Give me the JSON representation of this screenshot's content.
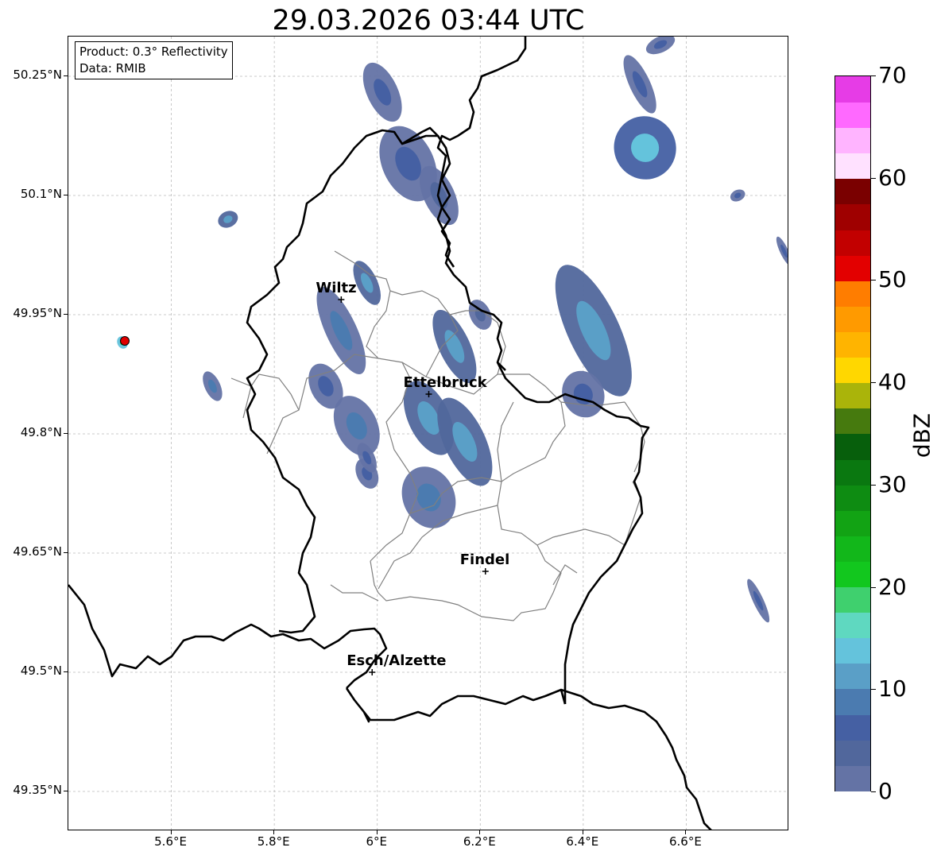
{
  "title": "29.03.2026 03:44 UTC",
  "info": {
    "product": "Product: 0.3° Reflectivity",
    "data": "Data: RMIB"
  },
  "axes": {
    "lon_range": [
      5.4,
      6.8
    ],
    "lat_range": [
      49.3,
      50.3
    ],
    "x_ticks": [
      {
        "value": 5.6,
        "label": "5.6°E"
      },
      {
        "value": 5.8,
        "label": "5.8°E"
      },
      {
        "value": 6.0,
        "label": "6°E"
      },
      {
        "value": 6.2,
        "label": "6.2°E"
      },
      {
        "value": 6.4,
        "label": "6.4°E"
      },
      {
        "value": 6.6,
        "label": "6.6°E"
      }
    ],
    "y_ticks": [
      {
        "value": 50.25,
        "label": "50.25°N"
      },
      {
        "value": 50.1,
        "label": "50.1°N"
      },
      {
        "value": 49.95,
        "label": "49.95°N"
      },
      {
        "value": 49.8,
        "label": "49.8°N"
      },
      {
        "value": 49.65,
        "label": "49.65°N"
      },
      {
        "value": 49.5,
        "label": "49.5°N"
      },
      {
        "value": 49.35,
        "label": "49.35°N"
      }
    ],
    "grid": true
  },
  "cities": [
    {
      "name": "Wiltz",
      "lon": 5.93,
      "lat": 49.969
    },
    {
      "name": "Ettelbruck",
      "lon": 6.1,
      "lat": 49.85
    },
    {
      "name": "Findel",
      "lon": 6.21,
      "lat": 49.627
    },
    {
      "name": "Esch/Alzette",
      "lon": 5.99,
      "lat": 49.5
    }
  ],
  "radar_site": {
    "lon": 5.505,
    "lat": 49.915
  },
  "colorbar": {
    "label": "dBZ",
    "min": 0,
    "max": 70,
    "ticks": [
      {
        "value": 0,
        "label": "0"
      },
      {
        "value": 10,
        "label": "10"
      },
      {
        "value": 20,
        "label": "20"
      },
      {
        "value": 30,
        "label": "30"
      },
      {
        "value": 40,
        "label": "40"
      },
      {
        "value": 50,
        "label": "50"
      },
      {
        "value": 60,
        "label": "60"
      },
      {
        "value": 70,
        "label": "70"
      }
    ],
    "colors": [
      "#6473a5",
      "#51679c",
      "#4560a3",
      "#4b7bb0",
      "#5a9fc7",
      "#64c3dc",
      "#5fd8c0",
      "#3fd06e",
      "#12c71e",
      "#12b71a",
      "#12a314",
      "#0e8c12",
      "#0a7810",
      "#075f0c",
      "#467a0e",
      "#aab40a",
      "#ffd700",
      "#ffb400",
      "#ff9a00",
      "#ff7d00",
      "#e30000",
      "#c20000",
      "#9f0000",
      "#7a0000",
      "#ffe1ff",
      "#ffb4ff",
      "#ff69ff",
      "#e63ce6"
    ]
  },
  "echoes": [
    {
      "lon": 6.01,
      "lat": 50.23,
      "rx": 0.03,
      "ry": 0.04,
      "level": 2
    },
    {
      "lon": 6.06,
      "lat": 50.14,
      "rx": 0.05,
      "ry": 0.05,
      "level": 2
    },
    {
      "lon": 6.12,
      "lat": 50.1,
      "rx": 0.03,
      "ry": 0.04,
      "level": 1
    },
    {
      "lon": 5.71,
      "lat": 50.07,
      "rx": 0.02,
      "ry": 0.01,
      "level": 4
    },
    {
      "lon": 5.98,
      "lat": 49.99,
      "rx": 0.02,
      "ry": 0.03,
      "level": 4
    },
    {
      "lon": 5.93,
      "lat": 49.93,
      "rx": 0.03,
      "ry": 0.06,
      "level": 3
    },
    {
      "lon": 5.9,
      "lat": 49.86,
      "rx": 0.03,
      "ry": 0.03,
      "level": 2
    },
    {
      "lon": 5.96,
      "lat": 49.81,
      "rx": 0.04,
      "ry": 0.04,
      "level": 3
    },
    {
      "lon": 5.98,
      "lat": 49.75,
      "rx": 0.02,
      "ry": 0.02,
      "level": 2
    },
    {
      "lon": 6.1,
      "lat": 49.82,
      "rx": 0.04,
      "ry": 0.05,
      "level": 4
    },
    {
      "lon": 6.15,
      "lat": 49.91,
      "rx": 0.03,
      "ry": 0.05,
      "level": 4
    },
    {
      "lon": 6.2,
      "lat": 49.95,
      "rx": 0.02,
      "ry": 0.02,
      "level": 1
    },
    {
      "lon": 6.17,
      "lat": 49.79,
      "rx": 0.04,
      "ry": 0.06,
      "level": 4
    },
    {
      "lon": 6.1,
      "lat": 49.72,
      "rx": 0.05,
      "ry": 0.04,
      "level": 3
    },
    {
      "lon": 6.42,
      "lat": 49.93,
      "rx": 0.05,
      "ry": 0.09,
      "level": 4
    },
    {
      "lon": 6.4,
      "lat": 49.85,
      "rx": 0.04,
      "ry": 0.03,
      "level": 2
    },
    {
      "lon": 6.52,
      "lat": 50.16,
      "rx": 0.06,
      "ry": 0.04,
      "level": 5
    },
    {
      "lon": 6.51,
      "lat": 50.24,
      "rx": 0.02,
      "ry": 0.04,
      "level": 2
    },
    {
      "lon": 6.55,
      "lat": 50.29,
      "rx": 0.03,
      "ry": 0.01,
      "level": 2
    },
    {
      "lon": 5.68,
      "lat": 49.86,
      "rx": 0.015,
      "ry": 0.02,
      "level": 3
    },
    {
      "lon": 5.505,
      "lat": 49.915,
      "rx": 0.01,
      "ry": 0.008,
      "level": 8
    },
    {
      "lon": 6.74,
      "lat": 49.59,
      "rx": 0.01,
      "ry": 0.03,
      "level": 2
    },
    {
      "lon": 6.79,
      "lat": 50.03,
      "rx": 0.008,
      "ry": 0.02,
      "level": 2
    },
    {
      "lon": 6.7,
      "lat": 50.1,
      "rx": 0.015,
      "ry": 0.007,
      "level": 2
    },
    {
      "lon": 5.98,
      "lat": 49.77,
      "rx": 0.015,
      "ry": 0.02,
      "level": 2
    }
  ]
}
